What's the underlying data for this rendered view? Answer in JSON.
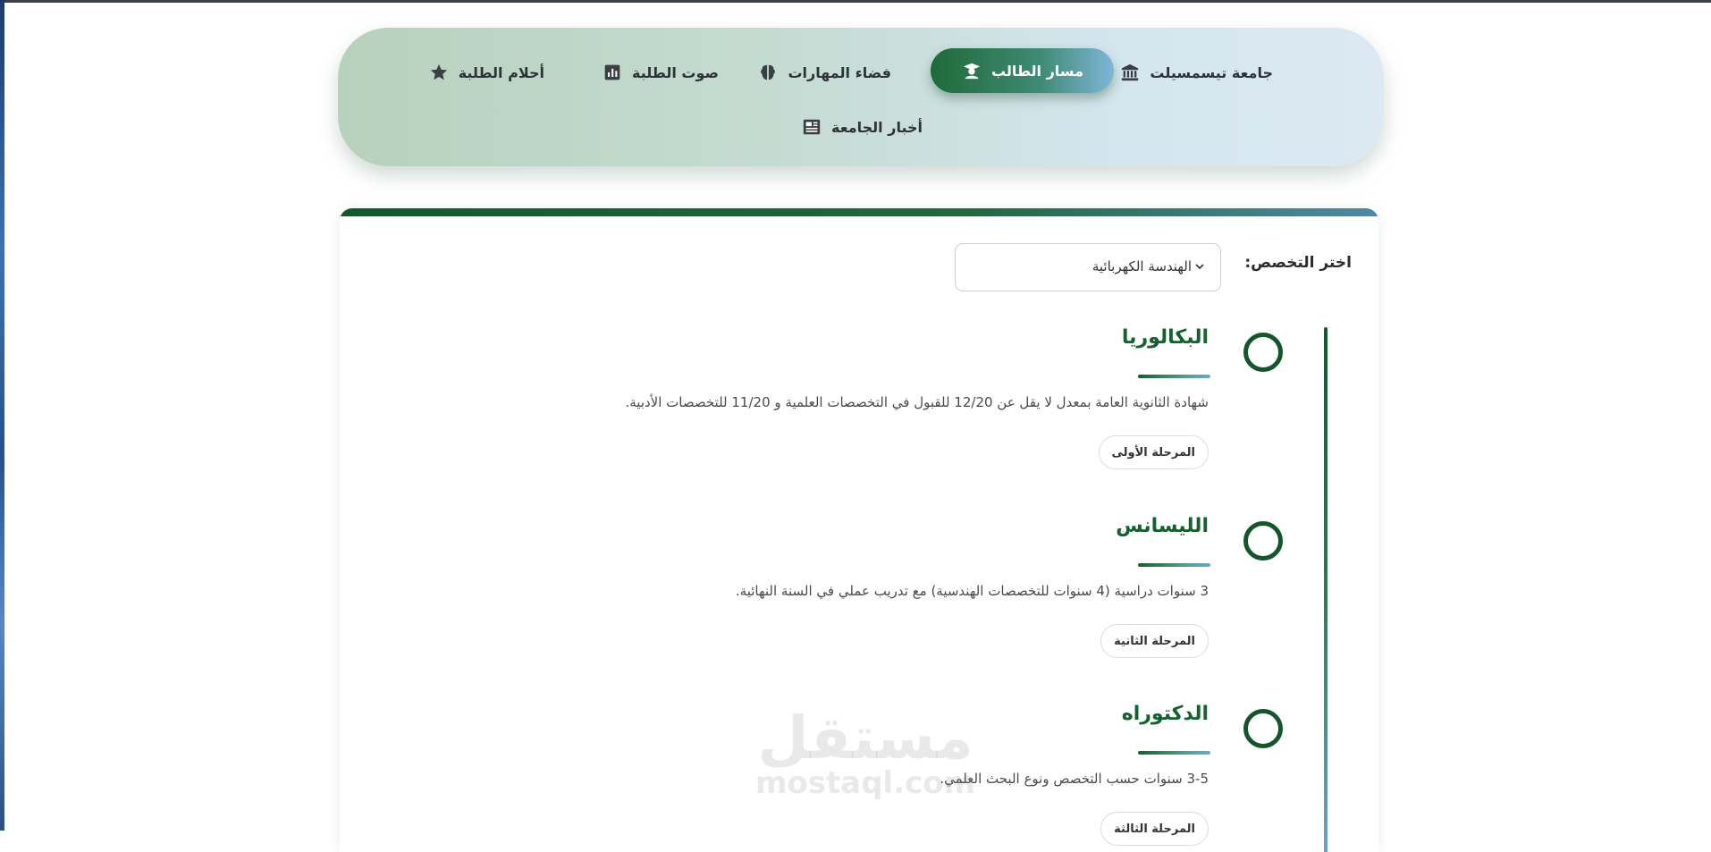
{
  "nav": {
    "items": [
      {
        "label": "جامعة تيسمسيلت",
        "icon": "university-icon",
        "active": false
      },
      {
        "label": "مسار الطالب",
        "icon": "graduate-icon",
        "active": true
      },
      {
        "label": "فضاء المهارات",
        "icon": "brain-icon",
        "active": false
      },
      {
        "label": "صوت الطلبة",
        "icon": "poll-icon",
        "active": false
      },
      {
        "label": "أحلام الطلبة",
        "icon": "star-icon",
        "active": false
      },
      {
        "label": "أخبار الجامعة",
        "icon": "newspaper-icon",
        "active": false
      }
    ]
  },
  "specialty": {
    "label": "اختر التخصص:",
    "selected": "الهندسة الكهربائية"
  },
  "timeline": {
    "steps": [
      {
        "title": "البكالوريا",
        "description": "شهادة الثانوية العامة بمعدل لا يقل عن 12/20 للقبول في التخصصات العلمية و 11/20 للتخصصات الأدبية.",
        "badge": "المرحلة الأولى"
      },
      {
        "title": "الليسانس",
        "description": "3 سنوات دراسية (4 سنوات للتخصصات الهندسية) مع تدريب عملي في السنة النهائية.",
        "badge": "المرحلة الثانية"
      },
      {
        "title": "الدكتوراه",
        "description": "3-5 سنوات حسب التخصص ونوع البحث العلمي.",
        "badge": "المرحلة الثالثة"
      }
    ]
  },
  "watermark": {
    "arabic": "مستقل",
    "latin": "mostaql.com"
  },
  "colors": {
    "primary_green": "#13612f",
    "accent_blue": "#6fa8d0"
  }
}
